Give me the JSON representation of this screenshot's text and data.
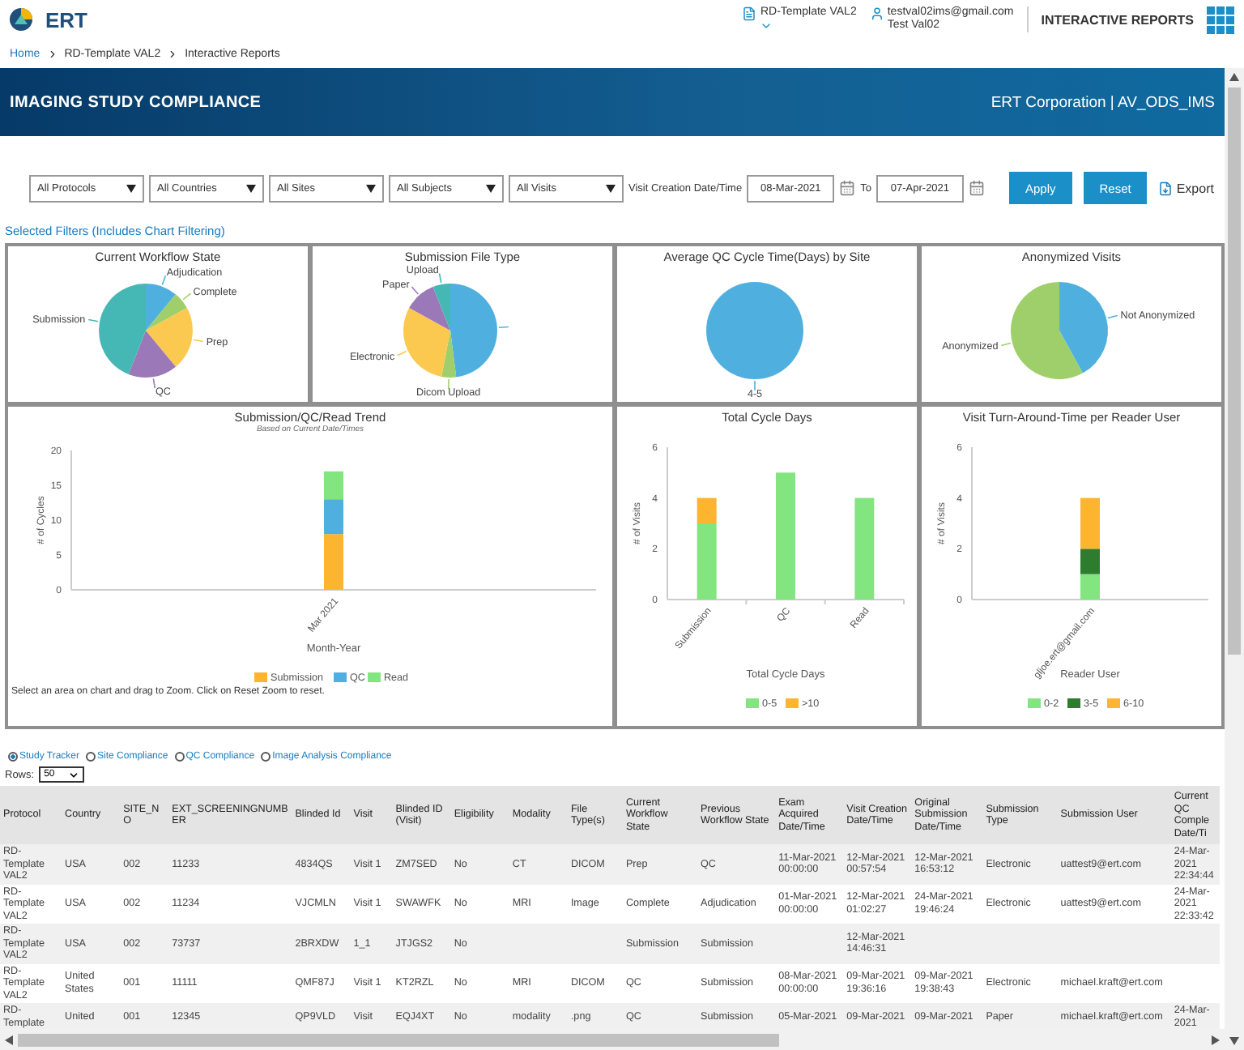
{
  "header": {
    "logo": "ERT",
    "project": "RD-Template VAL2",
    "user_email": "testval02ims@gmail.com",
    "user_name": "Test Val02",
    "app_title": "INTERACTIVE REPORTS"
  },
  "breadcrumb": [
    "Home",
    "RD-Template VAL2",
    "Interactive Reports"
  ],
  "banner": {
    "title": "IMAGING STUDY COMPLIANCE",
    "org": "ERT Corporation | AV_ODS_IMS"
  },
  "filters": {
    "dropdowns": [
      "All Protocols",
      "All Countries",
      "All Sites",
      "All Subjects",
      "All Visits"
    ],
    "date_label": "Visit Creation Date/Time",
    "date_from": "08-Mar-2021",
    "to_label": "To",
    "date_to": "07-Apr-2021",
    "buttons": [
      "Apply",
      "Reset"
    ],
    "export": "Export"
  },
  "selected_filters_label": "Selected Filters (Includes Chart Filtering)",
  "charts": [
    {
      "chart_data": {
        "type": "pie",
        "title": "Current Workflow State",
        "categories": [
          "Adjudication",
          "Complete",
          "Prep",
          "QC",
          "Submission"
        ],
        "series": [
          {
            "values": [
              11,
              6,
              22,
              17,
              44
            ]
          }
        ]
      }
    },
    {
      "chart_data": {
        "type": "pie",
        "title": "Submission File Type",
        "categories": [
          null,
          "Dicom Upload",
          "Electronic",
          "Paper",
          "Upload"
        ],
        "series": [
          {
            "values": [
              48,
              5,
              30,
              11,
              6
            ]
          }
        ]
      }
    },
    {
      "chart_data": {
        "type": "pie",
        "title": "Average QC Cycle Time(Days) by Site",
        "categories": [
          "4-5"
        ],
        "series": [
          {
            "values": [
              100
            ]
          }
        ]
      }
    },
    {
      "chart_data": {
        "type": "pie",
        "title": "Anonymized Visits",
        "categories": [
          "Not Anonymized",
          "Anonymized"
        ],
        "series": [
          {
            "values": [
              42,
              58
            ]
          }
        ]
      }
    },
    {
      "subtitle": "Based on Current Date/Times",
      "note": "Select an area on chart and drag to Zoom. Click on Reset Zoom to reset.",
      "chart_data": {
        "type": "bar",
        "stacked": true,
        "legend": "bottom",
        "title": "Submission/QC/Read Trend",
        "xlabel": "Month-Year",
        "ylabel": "# of Cycles",
        "categories": [
          "Mar 2021"
        ],
        "ylim": [
          0,
          20
        ],
        "yticks": [
          0,
          5,
          10,
          15,
          20
        ],
        "series": [
          {
            "name": "Submission",
            "color": "#fdb52f",
            "values": [
              8
            ]
          },
          {
            "name": "QC",
            "color": "#4fb0e0",
            "values": [
              5
            ]
          },
          {
            "name": "Read",
            "color": "#82e57f",
            "values": [
              4
            ]
          }
        ]
      }
    },
    {
      "chart_data": {
        "type": "bar",
        "stacked": true,
        "legend": "bottom",
        "title": "Total Cycle Days",
        "xlabel": "Total Cycle Days",
        "ylabel": "# of Visits",
        "categories": [
          "Submission",
          "QC",
          "Read"
        ],
        "ylim": [
          0,
          6
        ],
        "yticks": [
          0,
          2,
          4,
          6
        ],
        "series": [
          {
            "name": "0-5",
            "color": "#82e57f",
            "values": [
              3,
              5,
              4
            ]
          },
          {
            "name": ">10",
            "color": "#fdb52f",
            "values": [
              1,
              null,
              null
            ]
          }
        ]
      }
    },
    {
      "chart_data": {
        "type": "bar",
        "stacked": true,
        "legend": "bottom",
        "title": "Visit Turn-Around-Time per Reader User",
        "xlabel": "Reader User",
        "ylabel": "# of Visits",
        "categories": [
          "gljoe.ert@gmail.com"
        ],
        "ylim": [
          0,
          6
        ],
        "yticks": [
          0,
          2,
          4,
          6
        ],
        "series": [
          {
            "name": "0-2",
            "color": "#82e57f",
            "values": [
              1
            ]
          },
          {
            "name": "3-5",
            "color": "#2e7d2e",
            "values": [
              1
            ]
          },
          {
            "name": "6-10",
            "color": "#fdb52f",
            "values": [
              2
            ]
          }
        ]
      }
    }
  ],
  "reports": [
    {
      "label": "Study Tracker",
      "selected": true
    },
    {
      "label": "Site Compliance",
      "selected": false
    },
    {
      "label": "QC Compliance",
      "selected": false
    },
    {
      "label": "Image Analysis Compliance",
      "selected": false
    }
  ],
  "rows_label": "Rows:",
  "rows_value": "50",
  "table": {
    "columns": [
      "Protocol",
      "Country",
      "SITE_NO",
      "EXT_SCREENINGNUMBER",
      "Blinded Id",
      "Visit",
      "Blinded ID (Visit)",
      "Eligibility",
      "Modality",
      "File Type(s)",
      "Current Workflow State",
      "Previous Workflow State",
      "Exam Acquired Date/Time",
      "Visit Creation Date/Time",
      "Original Submission Date/Time",
      "Submission Type",
      "Submission User",
      "Current QC Comple Date/Ti"
    ],
    "rows": [
      [
        "RD-Template VAL2",
        "USA",
        "002",
        "11233",
        "4834QS",
        "Visit 1",
        "ZM7SED",
        "No",
        "CT",
        "DICOM",
        "Prep",
        "QC",
        "11-Mar-2021 00:00:00",
        "12-Mar-2021 00:57:54",
        "12-Mar-2021 16:53:12",
        "Electronic",
        "uattest9@ert.com",
        "24-Mar-2021 22:34:44"
      ],
      [
        "RD-Template VAL2",
        "USA",
        "002",
        "11234",
        "VJCMLN",
        "Visit 1",
        "SWAWFK",
        "No",
        "MRI",
        "Image",
        "Complete",
        "Adjudication",
        "01-Mar-2021 00:00:00",
        "12-Mar-2021 01:02:27",
        "24-Mar-2021 19:46:24",
        "Electronic",
        "uattest9@ert.com",
        "24-Mar-2021 22:33:42"
      ],
      [
        "RD-Template VAL2",
        "USA",
        "002",
        "73737",
        "2BRXDW",
        "1_1",
        "JTJGS2",
        "No",
        null,
        null,
        "Submission",
        "Submission",
        null,
        "12-Mar-2021 14:46:31",
        null,
        null,
        null,
        null
      ],
      [
        "RD-Template VAL2",
        "United States",
        "001",
        "11111",
        "QMF87J",
        "Visit 1",
        "KT2RZL",
        "No",
        "MRI",
        "DICOM",
        "QC",
        "Submission",
        "08-Mar-2021 00:00:00",
        "09-Mar-2021 19:36:16",
        "09-Mar-2021 19:38:43",
        "Electronic",
        "michael.kraft@ert.com",
        null
      ],
      [
        "RD-Template",
        "United",
        "001",
        "12345",
        "QP9VLD",
        "Visit",
        "EQJ4XT",
        "No",
        "modality",
        ".png",
        "QC",
        "Submission",
        "05-Mar-2021",
        "09-Mar-2021",
        "09-Mar-2021",
        "Paper",
        "michael.kraft@ert.com",
        "24-Mar-2021"
      ]
    ]
  }
}
